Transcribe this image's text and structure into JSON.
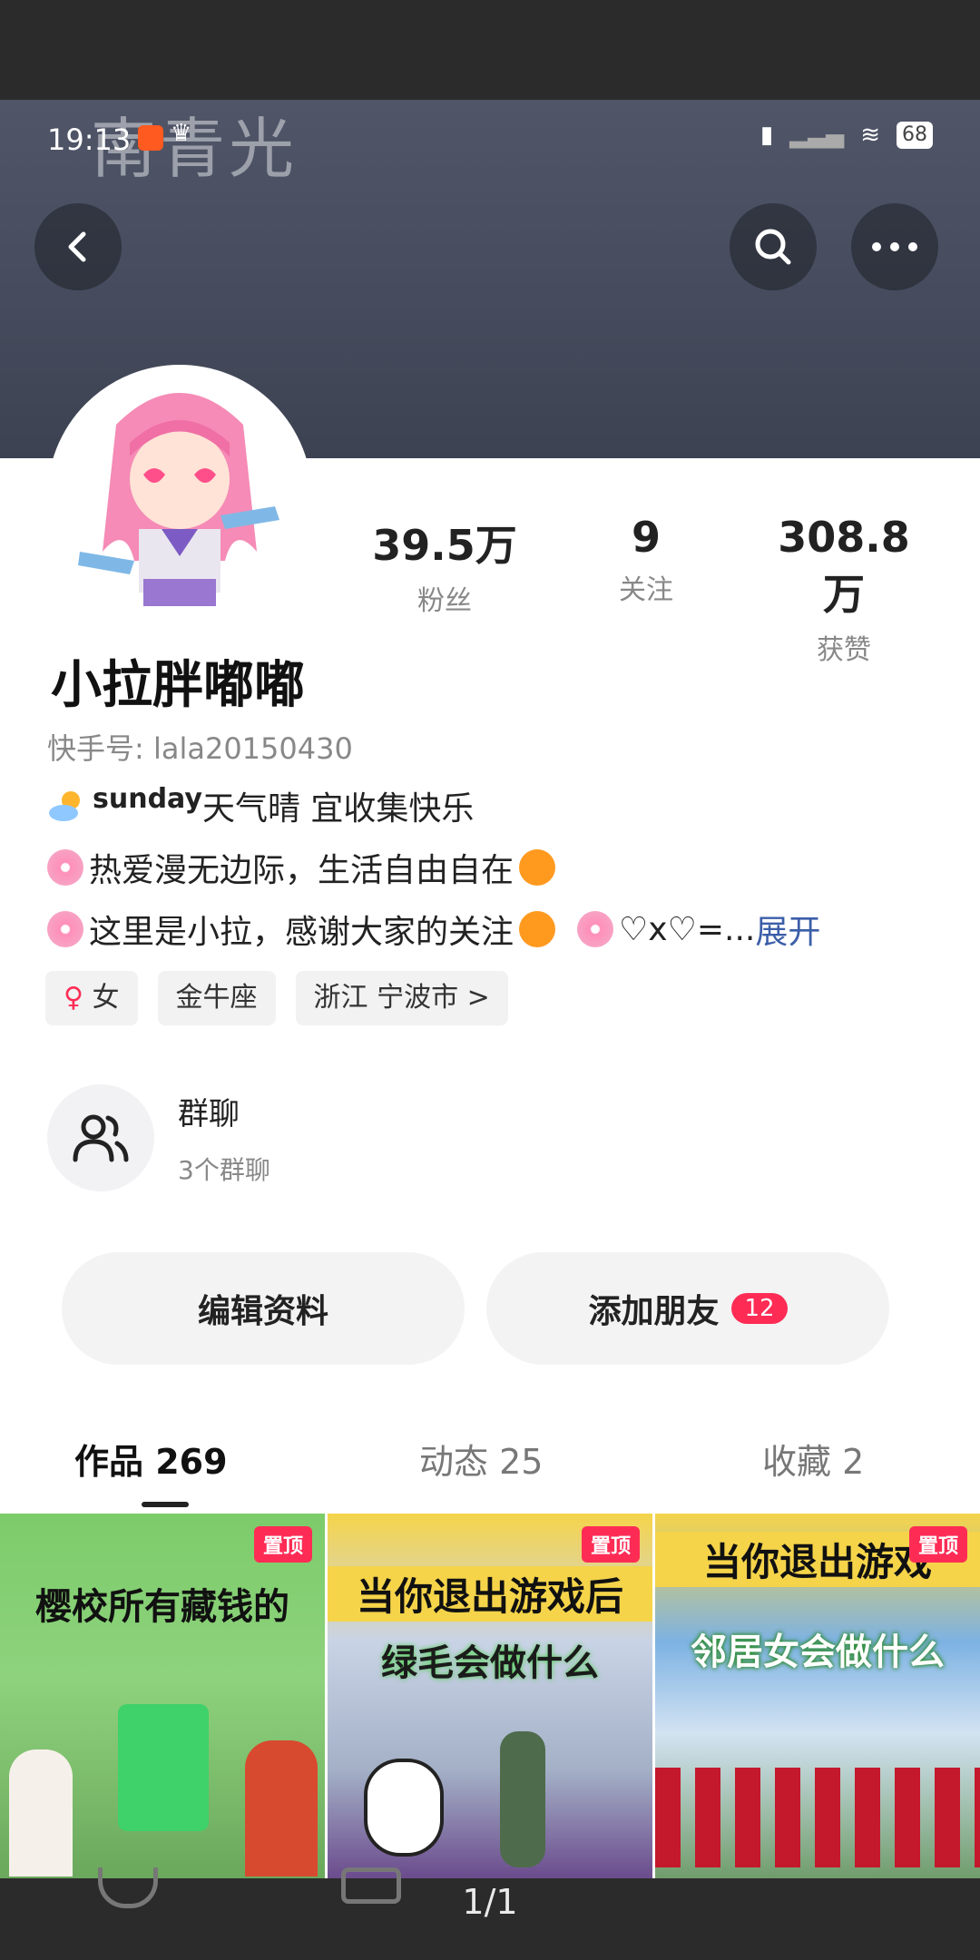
{
  "status_bar": {
    "time": "19:13",
    "battery": "68",
    "watermark": "南青光"
  },
  "header": {
    "back_icon": "chevron-left-icon",
    "search_icon": "search-icon",
    "more_icon": "more-horizontal-icon"
  },
  "profile": {
    "nickname": "小拉胖嘟嘟",
    "user_id": "快手号: lala20150430",
    "stats": [
      {
        "value": "39.5万",
        "label": "粉丝"
      },
      {
        "value": "9",
        "label": "关注"
      },
      {
        "value": "308.8万",
        "label": "获赞"
      }
    ],
    "bio": {
      "line1_en": "sunday",
      "line1": " 天气晴 宜收集快乐",
      "line2": "热爱漫无边际，生活自由自在",
      "line3": "这里是小拉，感谢大家的关注",
      "line3_tail": "♡x♡=...",
      "expand": "展开"
    },
    "tags": {
      "gender": "女",
      "zodiac": "金牛座",
      "location": "浙江 宁波市 >"
    }
  },
  "group_chat": {
    "title": "群聊",
    "subtitle": "3个群聊"
  },
  "actions": {
    "edit_profile": "编辑资料",
    "add_friend": "添加朋友",
    "add_friend_badge": "12"
  },
  "tabs": [
    {
      "label": "作品 269"
    },
    {
      "label": "动态 25"
    },
    {
      "label": "收藏 2"
    }
  ],
  "videos": [
    {
      "pinned": "置顶",
      "title": "樱校所有藏钱的"
    },
    {
      "pinned": "置顶",
      "title": "当你退出游戏后",
      "subtitle": "绿毛会做什么"
    },
    {
      "pinned": "置顶",
      "title": "当你退出游戏",
      "subtitle": "邻居女会做什么"
    }
  ],
  "viewer": {
    "page_indicator": "1/1"
  },
  "colors": {
    "accent": "#fe2c55",
    "banner": "#4a5062"
  }
}
